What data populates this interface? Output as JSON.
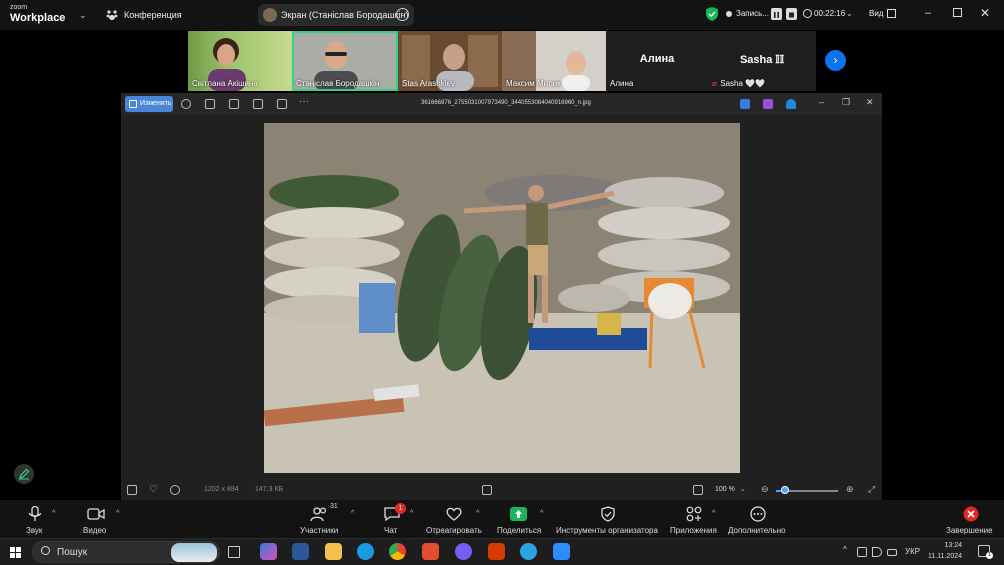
{
  "app": {
    "logo_top": "zoom",
    "logo_bottom": "Workplace",
    "meeting_label": "Конференция",
    "screen_share_label": "Экран (Станіслав Бородашкін)",
    "recording_label": "Запись...",
    "timer": "00:22:16",
    "view_label": "Вид",
    "accent_color": "#0e72ed",
    "active_speaker_color": "#2dd38a"
  },
  "participants": [
    {
      "name": "Світлана Акішина",
      "muted": false
    },
    {
      "name": "Станіслав Бородашкін",
      "muted": false,
      "active": true
    },
    {
      "name": "Stas Arashkiev",
      "muted": false
    },
    {
      "name": "Максим Милик",
      "muted": false
    },
    {
      "name": "Алина",
      "display": "Алина",
      "muted": false
    },
    {
      "name": "Sasha 🤍🤍",
      "display": "Sasha 𝕀𝕀",
      "muted": true
    }
  ],
  "viewer": {
    "edit_label": "Изменить",
    "filename": "361666876_2755031007973490_3440553084040916960_n.jpg",
    "dimensions": "1202 x 884",
    "file_size": "147,3 КБ",
    "zoom": "100 %",
    "zoom_fraction": 0.15
  },
  "toolbar": {
    "audio": "Звук",
    "video": "Видео",
    "participants": "Участники",
    "participants_count": "31",
    "chat": "Чат",
    "chat_badge": "1",
    "react": "Отреагировать",
    "share": "Поделиться",
    "host_tools": "Инструменты организатора",
    "apps": "Приложения",
    "more": "Дополнительно",
    "end": "Завершение"
  },
  "taskbar": {
    "search_label": "Пошук",
    "language": "УКР",
    "time": "13:24",
    "date": "11.11.2024"
  }
}
